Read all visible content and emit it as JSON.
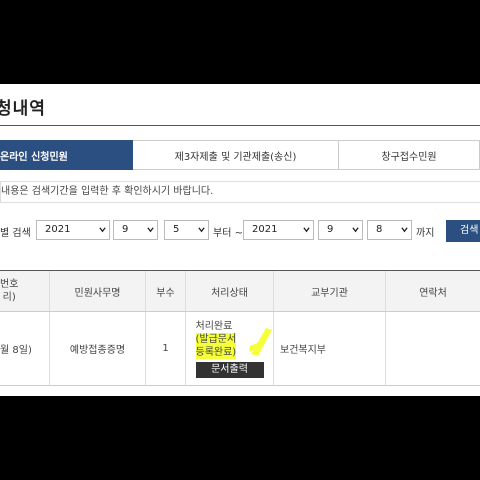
{
  "page": {
    "title": "청내역"
  },
  "tabs": [
    {
      "label": "온라인 신청민원",
      "active": true
    },
    {
      "label": "제3자제출 및 기관제출(송신)",
      "active": false
    },
    {
      "label": "창구접수민원",
      "active": false
    }
  ],
  "notice": "내용은 검색기간을 입력한 후 확인하시기 바랍니다.",
  "search": {
    "label": "별 검색",
    "start_year": "2021",
    "start_month": "9",
    "start_day": "5",
    "from_text": "부터 ~",
    "end_year": "2021",
    "end_month": "9",
    "end_day": "8",
    "to_text": "까지",
    "button": "검색"
  },
  "table": {
    "headers": {
      "col0_line1": "번호",
      "col0_line2": "리)",
      "col1": "민원사무명",
      "col2": "부수",
      "col3": "처리상태",
      "col4": "교부기관",
      "col5": "연락처"
    },
    "row": {
      "col0": "월 8일)",
      "col1": "예방접종증명",
      "col2": "1",
      "status_line1": "처리완료",
      "status_line2": "(발급문서",
      "status_line3": "등록완료)",
      "print_button": "문서출력",
      "col4": "보건복지부",
      "col5": ""
    }
  },
  "colors": {
    "accent": "#2b4f80",
    "highlight": "#f5ff3a",
    "print_button": "#333333"
  },
  "icons": [
    "chevron-down-icon"
  ]
}
